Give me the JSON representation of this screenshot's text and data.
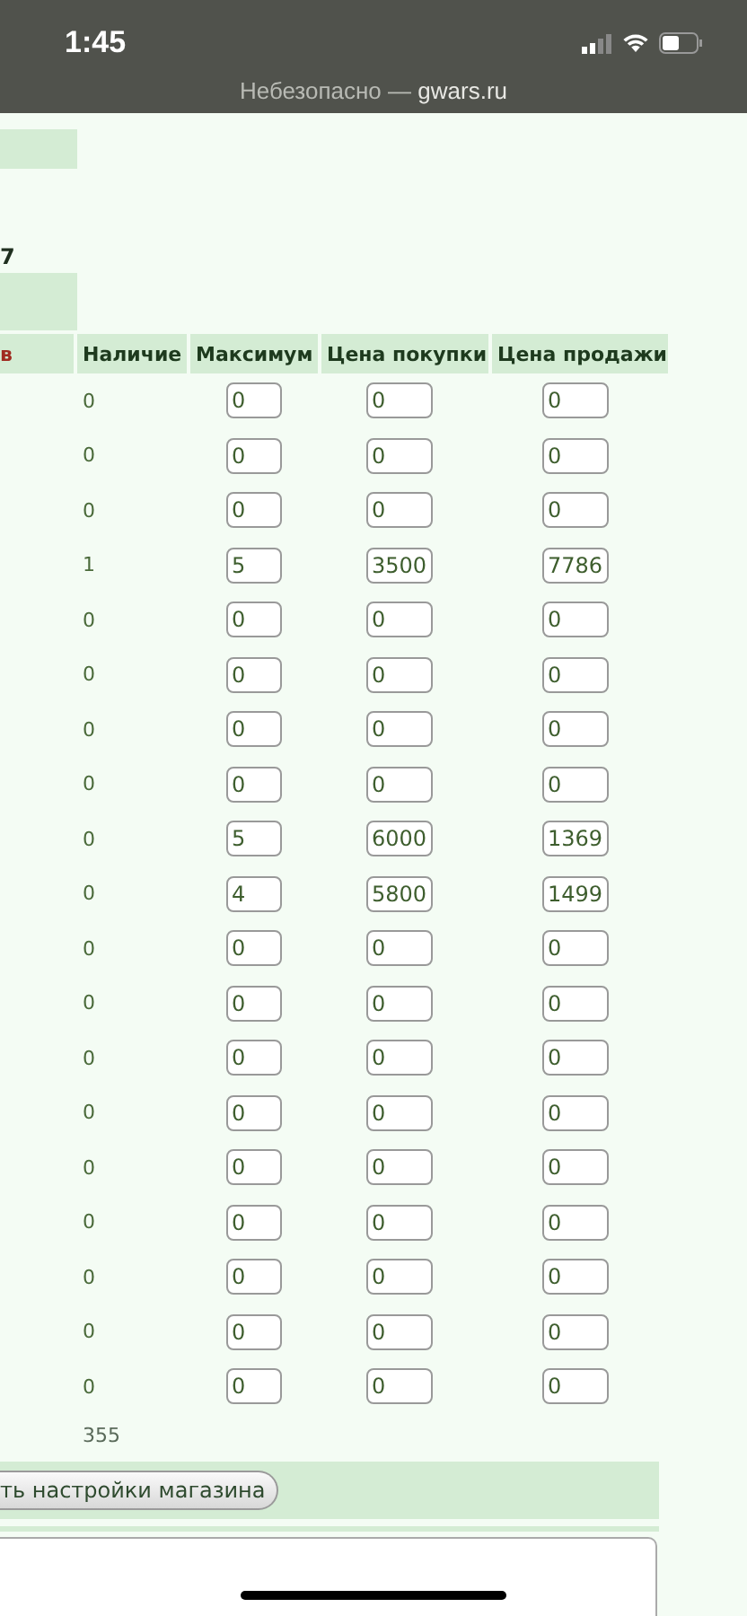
{
  "status_bar": {
    "time": "1:45"
  },
  "address_bar": {
    "security": "Небезопасно —",
    "domain": "gwars.ru"
  },
  "summary": {
    "value": "7"
  },
  "table": {
    "columns": [
      "в",
      "Наличие",
      "Максимум",
      "Цена покупки",
      "Цена продажи"
    ],
    "rows": [
      {
        "stock": "0",
        "max": "0",
        "buy": "0",
        "sell": "0"
      },
      {
        "stock": "0",
        "max": "0",
        "buy": "0",
        "sell": "0"
      },
      {
        "stock": "0",
        "max": "0",
        "buy": "0",
        "sell": "0"
      },
      {
        "stock": "1",
        "max": "5",
        "buy": "3500",
        "sell": "7786"
      },
      {
        "stock": "0",
        "max": "0",
        "buy": "0",
        "sell": "0"
      },
      {
        "stock": "0",
        "max": "0",
        "buy": "0",
        "sell": "0"
      },
      {
        "stock": "0",
        "max": "0",
        "buy": "0",
        "sell": "0"
      },
      {
        "stock": "0",
        "max": "0",
        "buy": "0",
        "sell": "0"
      },
      {
        "stock": "0",
        "max": "5",
        "buy": "6000",
        "sell": "1369"
      },
      {
        "stock": "0",
        "max": "4",
        "buy": "5800",
        "sell": "1499"
      },
      {
        "stock": "0",
        "max": "0",
        "buy": "0",
        "sell": "0"
      },
      {
        "stock": "0",
        "max": "0",
        "buy": "0",
        "sell": "0"
      },
      {
        "stock": "0",
        "max": "0",
        "buy": "0",
        "sell": "0"
      },
      {
        "stock": "0",
        "max": "0",
        "buy": "0",
        "sell": "0"
      },
      {
        "stock": "0",
        "max": "0",
        "buy": "0",
        "sell": "0"
      },
      {
        "stock": "0",
        "max": "0",
        "buy": "0",
        "sell": "0"
      },
      {
        "stock": "0",
        "max": "0",
        "buy": "0",
        "sell": "0"
      },
      {
        "stock": "0",
        "max": "0",
        "buy": "0",
        "sell": "0"
      },
      {
        "stock": "0",
        "max": "0",
        "buy": "0",
        "sell": "0"
      }
    ],
    "total": "355"
  },
  "save_button": {
    "label": "ть настройки магазина"
  }
}
